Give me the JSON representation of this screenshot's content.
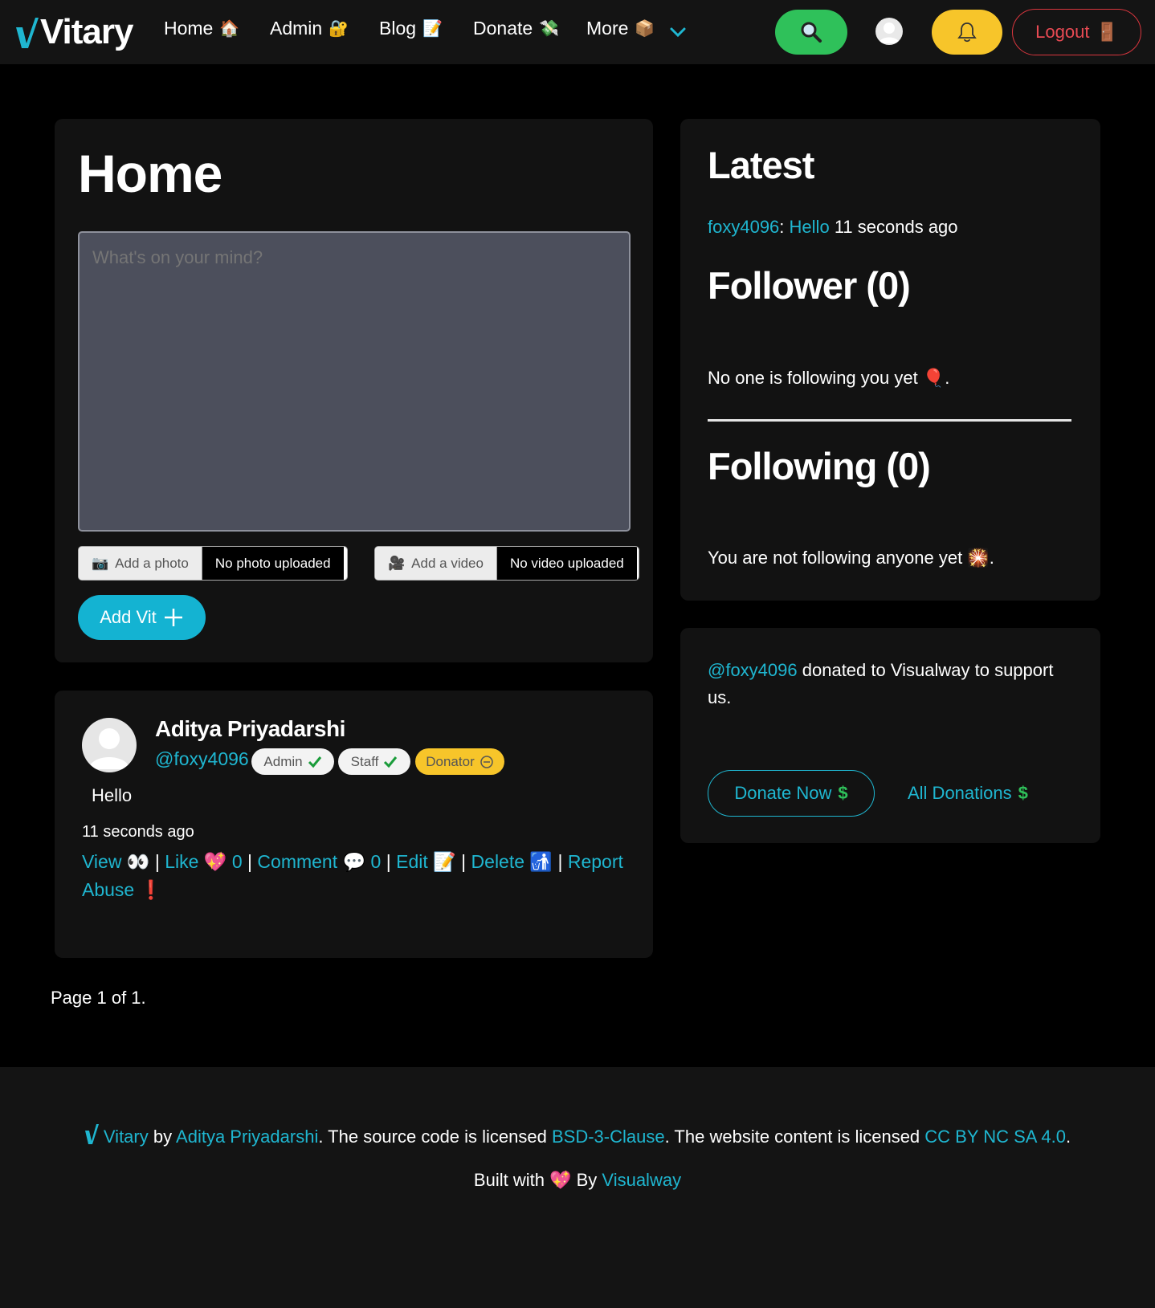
{
  "nav": {
    "brand": "Vitary",
    "items": [
      {
        "label": "Home",
        "emoji": "🏠"
      },
      {
        "label": "Admin",
        "emoji": "🔐"
      },
      {
        "label": "Blog",
        "emoji": "📝"
      },
      {
        "label": "Donate",
        "emoji": "💸"
      },
      {
        "label": "More",
        "emoji": "📦"
      }
    ],
    "logout_label": "Logout",
    "logout_emoji": "🚪"
  },
  "home": {
    "title": "Home",
    "placeholder": "What's on your mind?",
    "photo_button": "Add a photo",
    "photo_emoji": "📷",
    "photo_status": "No photo uploaded",
    "video_button": "Add a video",
    "video_emoji": "🎥",
    "video_status": "No video uploaded",
    "add_label": "Add Vit"
  },
  "post": {
    "name": "Aditya Priyadarshi",
    "handle": "@foxy4096",
    "badges": [
      {
        "label": "Admin",
        "icon": "check-icon"
      },
      {
        "label": "Staff",
        "icon": "check-icon"
      },
      {
        "label": "Donator",
        "icon": "donation-icon"
      }
    ],
    "body": "Hello",
    "time": "11 seconds ago",
    "actions": {
      "view": "View",
      "view_emoji": "👀",
      "like": "Like",
      "like_emoji": "💖",
      "like_count": "0",
      "comment": "Comment",
      "comment_emoji": "💬",
      "comment_count": "0",
      "edit": "Edit",
      "edit_emoji": "📝",
      "delete": "Delete",
      "delete_emoji": "🚮",
      "report": "Report Abuse",
      "report_emoji": "❗"
    }
  },
  "pagination": "Page 1 of 1.",
  "latest": {
    "title": "Latest",
    "user": "foxy4096",
    "sep": ":",
    "message": "Hello",
    "time": "11 seconds ago",
    "follower_title": "Follower (0)",
    "follower_text": "No one is following you yet",
    "follower_emoji": "🎈",
    "following_title": "Following (0)",
    "following_text": "You are not following anyone yet",
    "following_emoji": "🎇"
  },
  "donation": {
    "user": "@foxy4096",
    "text": "donated to Visualway to support us.",
    "donate_now": "Donate Now",
    "all_donations": "All Donations",
    "currency": "$"
  },
  "footer": {
    "brand": "Vitary",
    "by": "by",
    "author": "Aditya Priyadarshi",
    "source_text": ". The source code is licensed",
    "source_license": "BSD-3-Clause",
    "content_text": ". The website content is licensed",
    "content_license": "CC BY NC SA 4.0",
    "end": ".",
    "built_with": "Built with",
    "heart": "💖",
    "built_by": "By",
    "org": "Visualway"
  },
  "colors": {
    "accent": "#1fb6d0",
    "search": "#2fc15a",
    "bell": "#f7c52a",
    "logout": "#d9363e",
    "background": "#000000",
    "card": "#121212"
  }
}
